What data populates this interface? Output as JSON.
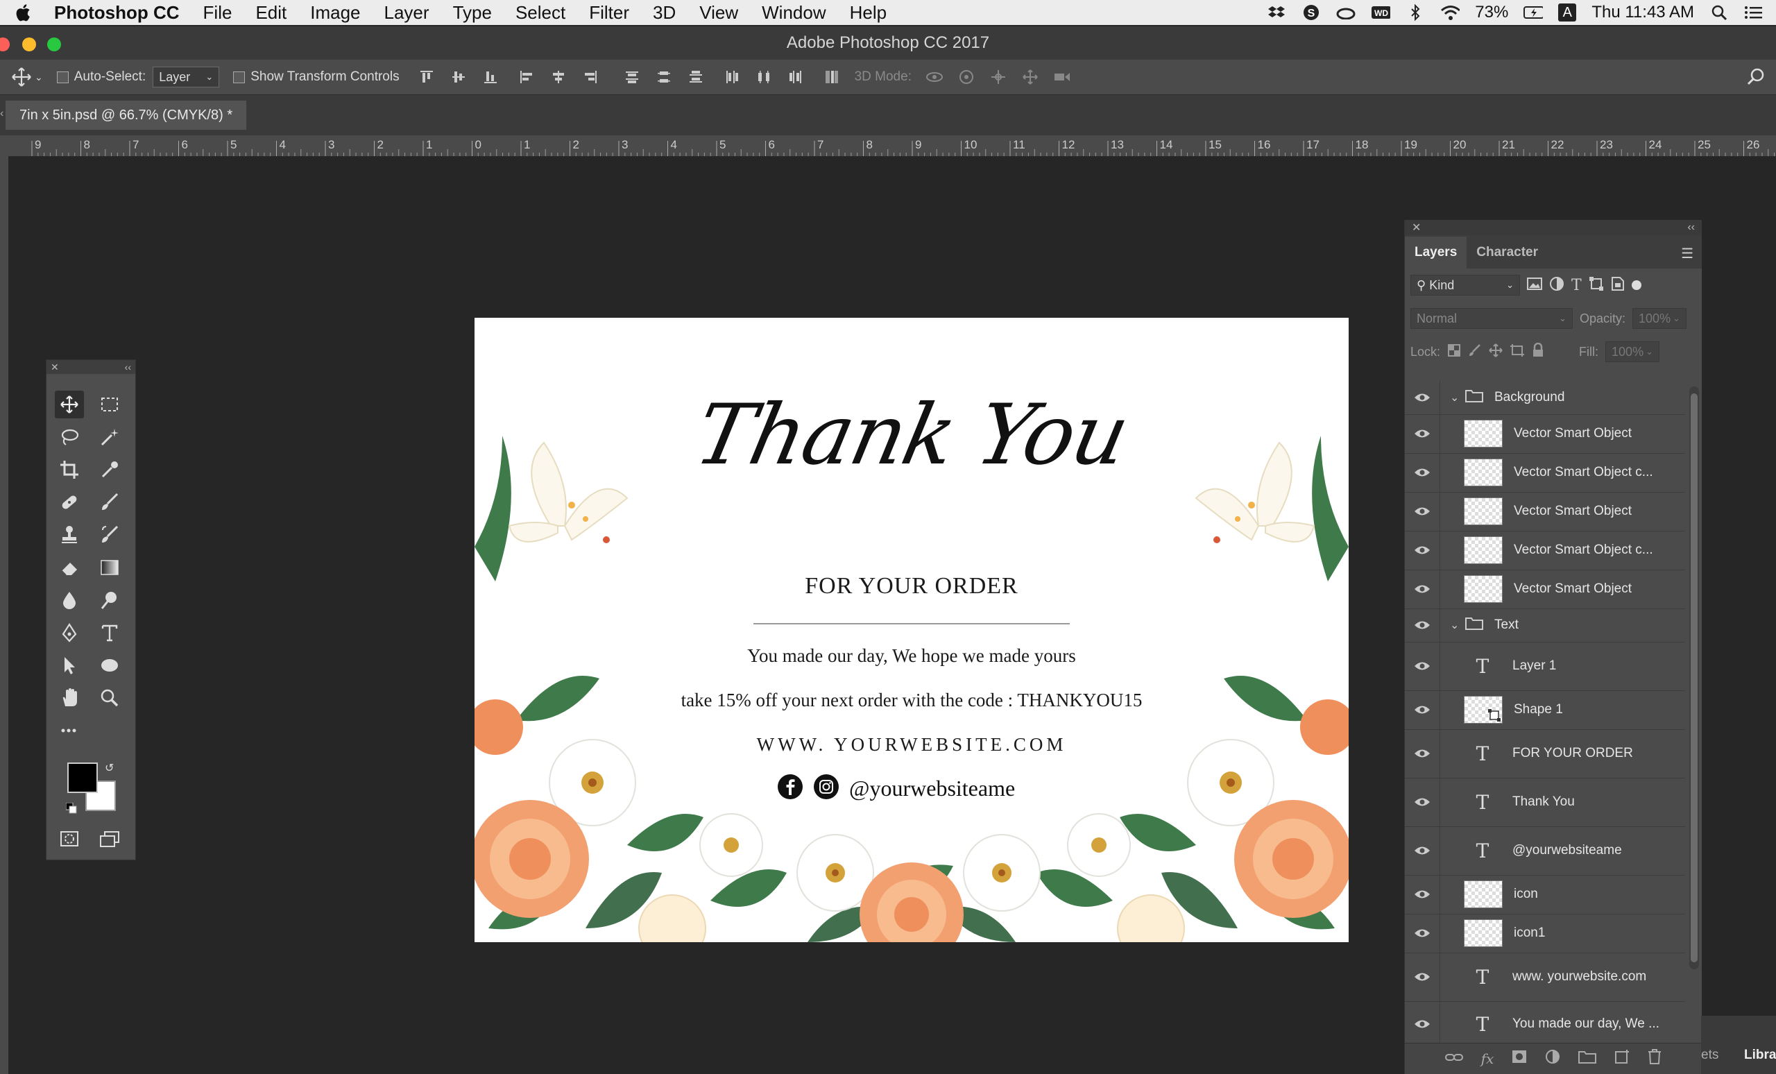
{
  "menubar": {
    "app_name": "Photoshop CC",
    "items": [
      "File",
      "Edit",
      "Image",
      "Layer",
      "Type",
      "Select",
      "Filter",
      "3D",
      "View",
      "Window",
      "Help"
    ],
    "battery": "73%",
    "clock": "Thu 11:43 AM",
    "input_source": "A"
  },
  "window": {
    "title": "Adobe Photoshop CC 2017"
  },
  "options": {
    "auto_select_label": "Auto-Select:",
    "auto_select_value": "Layer",
    "transform_label": "Show Transform Controls",
    "mode_3d_label": "3D Mode:"
  },
  "document": {
    "tab_label": "7in x 5in.psd @ 66.7% (CMYK/8) *"
  },
  "ruler": {
    "labels": [
      "9",
      "8",
      "7",
      "6",
      "5",
      "4",
      "3",
      "2",
      "1",
      "0",
      "1",
      "2",
      "3",
      "4",
      "5",
      "6",
      "7",
      "8",
      "9",
      "10",
      "11",
      "12",
      "13",
      "14",
      "15",
      "16",
      "17",
      "18",
      "19",
      "20",
      "21",
      "22",
      "23",
      "24",
      "25",
      "26"
    ]
  },
  "card": {
    "headline": "Thank You",
    "subheading": "FOR YOUR ORDER",
    "line1": "You made our day, We hope we made yours",
    "line2": "take 15% off your next order with the code : THANKYOU15",
    "website": "WWW. YOURWEBSITE.COM",
    "social_handle": "@yourwebsiteame"
  },
  "layers_panel": {
    "tab_layers": "Layers",
    "tab_character": "Character",
    "filter_kind": "Kind",
    "blend_mode": "Normal",
    "opacity_label": "Opacity:",
    "opacity_value": "100%",
    "lock_label": "Lock:",
    "fill_label": "Fill:",
    "fill_value": "100%",
    "rows": [
      {
        "name": "Background",
        "kind": "group"
      },
      {
        "name": "Vector Smart Object",
        "kind": "smart"
      },
      {
        "name": "Vector Smart Object c...",
        "kind": "smart"
      },
      {
        "name": "Vector Smart Object",
        "kind": "smart"
      },
      {
        "name": "Vector Smart Object c...",
        "kind": "smart"
      },
      {
        "name": "Vector Smart Object",
        "kind": "smart"
      },
      {
        "name": "Text",
        "kind": "group"
      },
      {
        "name": "Layer 1",
        "kind": "text"
      },
      {
        "name": "Shape 1",
        "kind": "shape"
      },
      {
        "name": "FOR YOUR ORDER",
        "kind": "text"
      },
      {
        "name": "Thank You",
        "kind": "text"
      },
      {
        "name": "@yourwebsiteame",
        "kind": "text"
      },
      {
        "name": "icon",
        "kind": "smart"
      },
      {
        "name": "icon1",
        "kind": "smart"
      },
      {
        "name": "www. yourwebsite.com",
        "kind": "text"
      },
      {
        "name": "You made our day, We ...",
        "kind": "text"
      }
    ]
  },
  "side_tabs": {
    "left": "ets",
    "right": "Libra"
  },
  "colors": {
    "accent_peach": "#f3a071",
    "leaf_green": "#3f7a4a",
    "foreground": "#000000",
    "background": "#ffffff"
  }
}
